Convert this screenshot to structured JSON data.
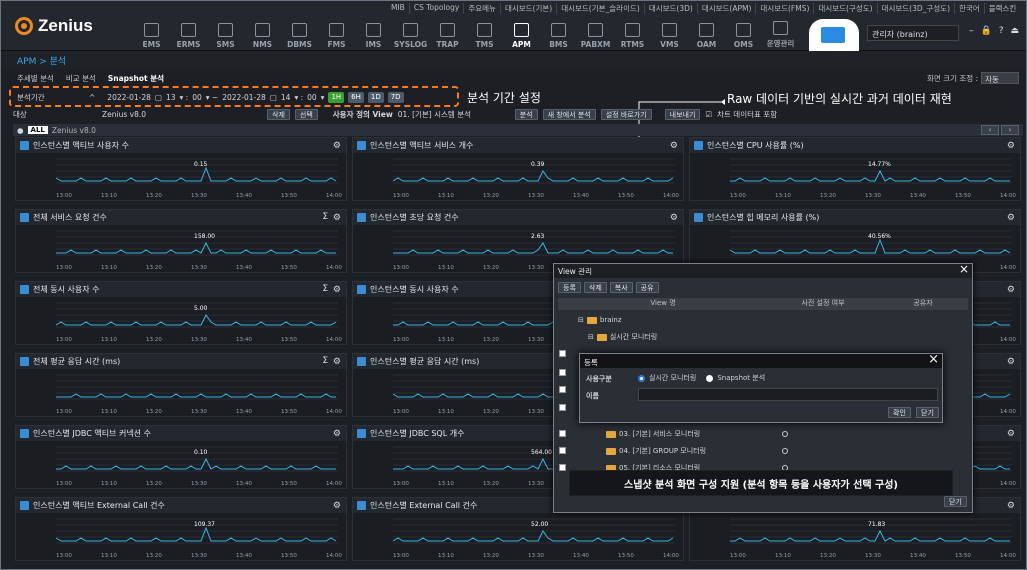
{
  "brand": "Zenius",
  "top_links": [
    "MIB",
    "CS Topology",
    "주요메뉴",
    "대시보드(기본)",
    "대시보드(기본_슬라이드)",
    "대시보드(3D)",
    "대시보드(APM)",
    "대시보드(FMS)",
    "대시보드(구성도)",
    "대시보드(3D_구성도)",
    "한국어",
    "블랙스킨"
  ],
  "modules": [
    {
      "label": "EMS"
    },
    {
      "label": "ERMS"
    },
    {
      "label": "SMS"
    },
    {
      "label": "NMS"
    },
    {
      "label": "DBMS"
    },
    {
      "label": "FMS"
    },
    {
      "label": "IMS"
    },
    {
      "label": "SYSLOG"
    },
    {
      "label": "TRAP"
    },
    {
      "label": "TMS"
    },
    {
      "label": "APM",
      "active": true
    },
    {
      "label": "BMS"
    },
    {
      "label": "PABXM"
    },
    {
      "label": "RTMS"
    },
    {
      "label": "VMS"
    },
    {
      "label": "OAM"
    },
    {
      "label": "OMS"
    },
    {
      "label": "운영관리"
    }
  ],
  "user": "관리자 (brainz)",
  "breadcrumb": "APM > 분석",
  "tabs": [
    "추세별 분석",
    "비교 분석",
    "Snapshot 분석"
  ],
  "size_label": "화면 크기 조정 :",
  "size_value": "자동",
  "period": {
    "label": "분석기간",
    "start_date": "2022-01-28",
    "start_hour": "13",
    "start_min": "00",
    "end_date": "2022-01-28",
    "end_hour": "14",
    "end_min": "00",
    "presets": [
      "1H",
      "6H",
      "1D",
      "7D"
    ],
    "active": "1H"
  },
  "annotations": {
    "period": "분석 기간 설정",
    "raw": "Raw 데이터 기반의 실시간 과거 데이터 재현",
    "snapshot": "스냅샷 분석 화면 구성 지원 (분석 항목 등을 사용자가 선택 구성)"
  },
  "target": {
    "label": "대상",
    "value": "Zenius v8.0",
    "delete": "삭제",
    "select": "선택",
    "view_label": "사용자 정의 View",
    "view_value": "01. [기본] 시스템 분석",
    "analyze": "분석",
    "new_window": "새 창에서 분석",
    "shortcut": "설정 바로가기",
    "export": "내보내기",
    "chart_table": "차트 데이터표 포함"
  },
  "instance": {
    "all": "ALL",
    "name": "Zenius v8.0"
  },
  "panels": [
    {
      "title": "인스턴스별 액티브 사용자 수",
      "label": "0.15",
      "sigma": false
    },
    {
      "title": "인스턴스별 액티브 서비스 개수",
      "label": "0.39",
      "sigma": false
    },
    {
      "title": "인스턴스별 CPU 사용률 (%)",
      "label": "14.77%",
      "sigma": false
    },
    {
      "title": "전체 서비스 요청 건수",
      "label": "158.00",
      "sigma": true
    },
    {
      "title": "인스턴스별 초당 요청 건수",
      "label": "2.63",
      "sigma": false
    },
    {
      "title": "인스턴스별 힙 메모리 사용률 (%)",
      "label": "40.56%",
      "sigma": false
    },
    {
      "title": "전체 동시 사용자 수",
      "label": "5.00",
      "sigma": true
    },
    {
      "title": "인스턴스별 동시 사용자 수",
      "label": "",
      "sigma": false
    },
    {
      "title": "량",
      "label": "",
      "sigma": false
    },
    {
      "title": "전체 평균 응답 시간 (ms)",
      "label": "",
      "sigma": true
    },
    {
      "title": "인스턴스별 평균 응답 시간 (ms)",
      "label": "",
      "sigma": false
    },
    {
      "title": "(ms)",
      "label": "",
      "sigma": false
    },
    {
      "title": "인스턴스별 JDBC 액티브 커넥션 수",
      "label": "0.10",
      "sigma": false
    },
    {
      "title": "인스턴스별 JDBC SQL 개수",
      "label": "564.00",
      "sigma": false
    },
    {
      "title": "간 (ms)",
      "label": "",
      "sigma": false
    },
    {
      "title": "인스턴스별 액티브 External Call 건수",
      "label": "109.37",
      "sigma": false
    },
    {
      "title": "인스턴스별 External Call 건수",
      "label": "52.00",
      "sigma": false
    },
    {
      "title": "",
      "label": "71.83",
      "sigma": false
    }
  ],
  "x_ticks": [
    "13:00",
    "13:10",
    "13:20",
    "13:30",
    "13:40",
    "13:50",
    "14:00"
  ],
  "view_manager": {
    "title": "View 관리",
    "buttons": [
      "등록",
      "삭제",
      "복사",
      "공유"
    ],
    "columns": [
      "View 명",
      "사전 설정 여부",
      "공유자"
    ],
    "tree": [
      "brainz",
      "실시간 모니터링",
      "03. [기본] 서비스 모니터링",
      "04. [기본] GROUP 모니터링",
      "05. [기본] 리소스 모니터링"
    ],
    "close_btn": "닫기"
  },
  "register": {
    "title": "등록",
    "kind_label": "사용구분",
    "opt1": "실시간 모니터링",
    "opt2": "Snapshot 분석",
    "name_label": "이름",
    "ok": "확인",
    "close": "닫기"
  },
  "colors": {
    "accent": "#f08a1c",
    "line": "#36b7e6",
    "active_preset": "#39a032"
  }
}
